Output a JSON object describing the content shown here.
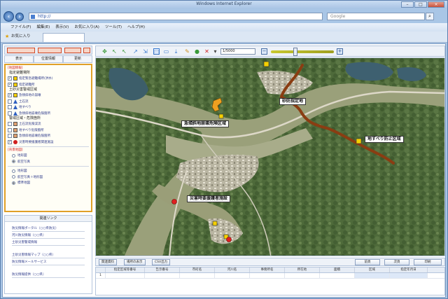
{
  "browser": {
    "title": "Windows Internet Explorer",
    "address": "http://",
    "search_placeholder": "Google",
    "menu": [
      "ファイル(F)",
      "編集(E)",
      "表示(V)",
      "お気に入り(A)",
      "ツール(T)",
      "ヘルプ(H)"
    ],
    "favorites_label": "お気に入り"
  },
  "left_panel": {
    "buttons": [
      "表示",
      "位置情報",
      "更新"
    ],
    "section1_title": "[地図情報]",
    "groups": [
      {
        "title": "指定避難場所",
        "items": [
          {
            "label": "指定緊急避難場所(洪水)",
            "checked": true,
            "symbol": "square",
            "color": "#f5d000"
          },
          {
            "label": "指定避難所",
            "checked": true,
            "symbol": "square",
            "color": "#f5d000"
          }
        ]
      },
      {
        "title": "土砂災害警戒区域",
        "items": [
          {
            "label": "急傾斜地の崩壊",
            "checked": true,
            "symbol": "square",
            "color": "#f5d000"
          },
          {
            "label": "土石流",
            "checked": false,
            "symbol": "triangle",
            "color": "#3060c0"
          },
          {
            "label": "地すべり",
            "checked": false,
            "symbol": "triangle",
            "color": "#3060c0"
          },
          {
            "label": "急傾斜地崩壊危険箇所",
            "checked": false,
            "symbol": "triangle",
            "color": "#3060c0"
          }
        ]
      },
      {
        "title": "警戒区域・危険箇所",
        "items": [
          {
            "label": "土石流危険渓流",
            "checked": false,
            "symbol": "square",
            "color": "#e0a070"
          },
          {
            "label": "地すべり危険箇所",
            "checked": false,
            "symbol": "square",
            "color": "#e0a070"
          },
          {
            "label": "急傾斜地崩壊危険箇所",
            "checked": false,
            "symbol": "square",
            "color": "#e0a070"
          },
          {
            "label": "災害時要援護者関連施設",
            "checked": true,
            "symbol": "circle",
            "color": "#d02020"
          }
        ]
      }
    ],
    "section2_title": "[背景地図]",
    "backgrounds": [
      {
        "label": "地形図",
        "selected": false
      },
      {
        "label": "航空写真",
        "selected": true
      },
      {
        "label": "地形図",
        "selected": false
      },
      {
        "label": "航空写真＋地形図",
        "selected": false
      },
      {
        "label": "標準地図",
        "selected": true
      }
    ],
    "links_title": "関連リンク",
    "links": [
      "防災情報ポータル（○○県防災）",
      "河川防災情報（○○県）",
      "土砂災害警戒情報",
      "土砂災害情報マップ（○○県）",
      "防災情報メールサービス",
      "防災情報提供（○○県）"
    ]
  },
  "map": {
    "scale": "1/5000",
    "labels": [
      "砂防指定地",
      "急傾斜地崩壊危険区域",
      "地すべり防止区域",
      "災害時要援護者施設"
    ]
  },
  "grid": {
    "left_buttons": [
      "関連資料",
      "場所の表示",
      "CSV出力"
    ],
    "right_buttons": [
      "前頁",
      "次頁",
      "印刷"
    ],
    "columns": [
      "指定区域等番号",
      "告示番号",
      "市町名",
      "河川名",
      "事務所名",
      "所在地",
      "面積",
      "区域",
      "指定年月日"
    ],
    "rows": [
      [
        "1",
        "",
        "",
        "",
        "",
        "",
        "",
        "",
        ""
      ]
    ]
  }
}
